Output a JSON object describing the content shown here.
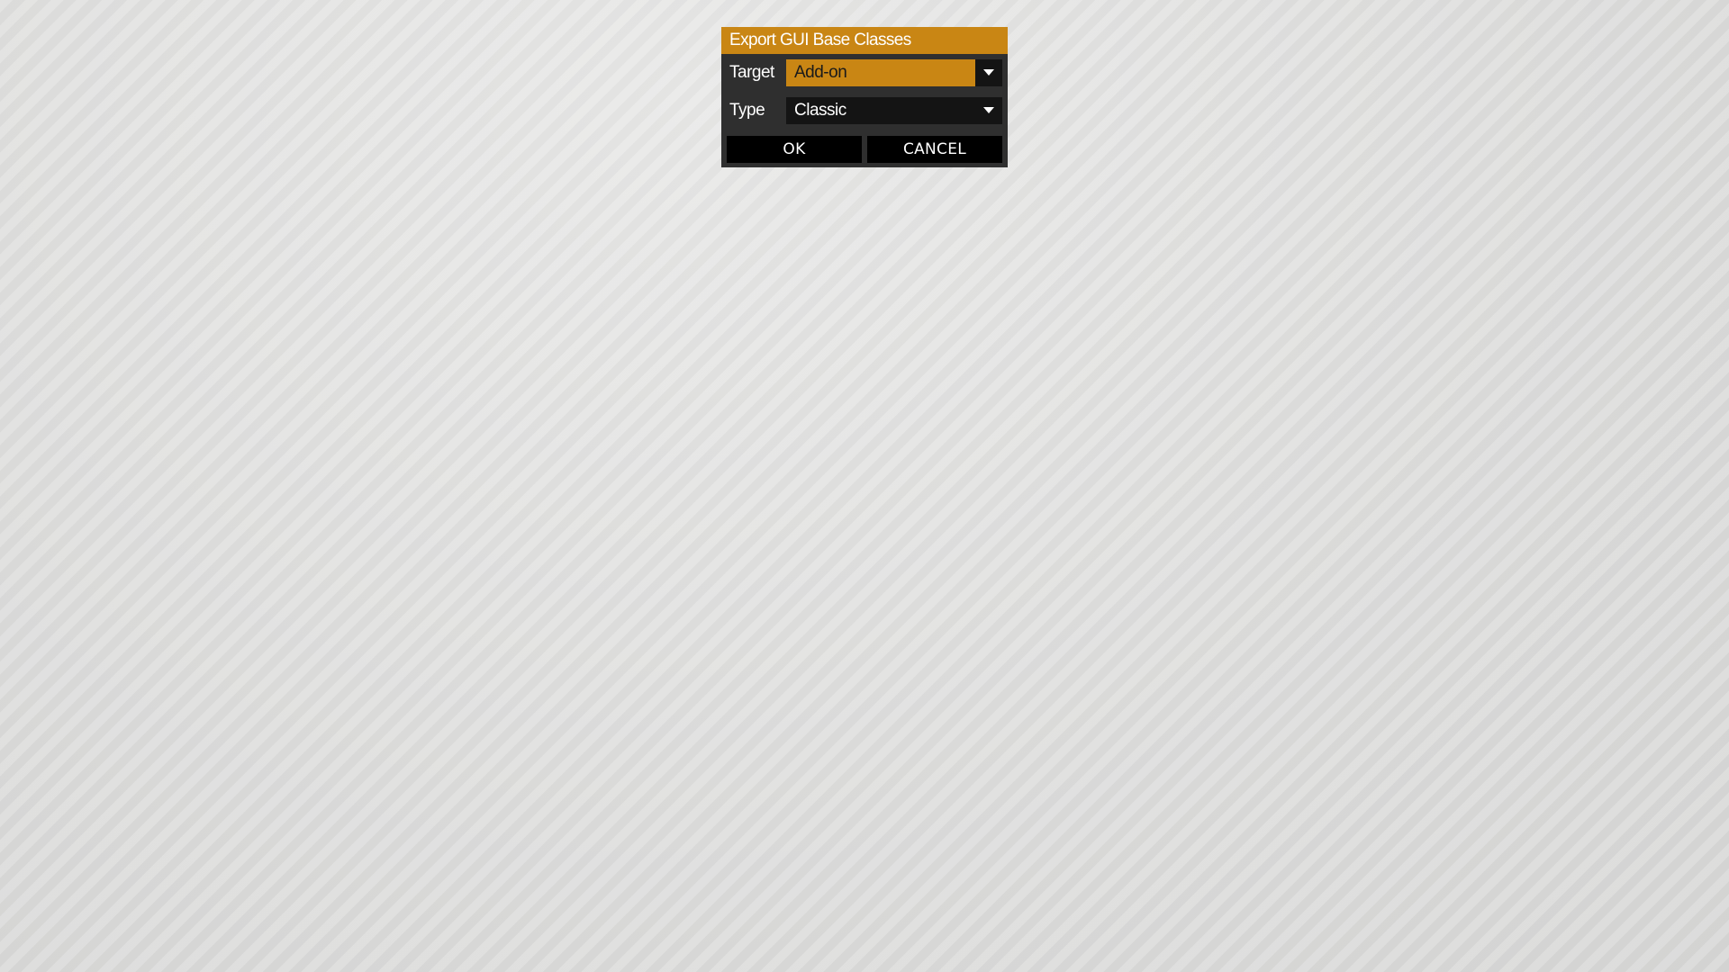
{
  "dialog": {
    "title": "Export GUI Base Classes",
    "target": {
      "label": "Target",
      "value": "Add-on"
    },
    "type": {
      "label": "Type",
      "value": "Classic"
    },
    "ok_label": "OK",
    "cancel_label": "CANCEL"
  },
  "colors": {
    "accent": "#c98614",
    "panel": "#2f2f2f",
    "field": "#141414",
    "button": "#000000"
  }
}
